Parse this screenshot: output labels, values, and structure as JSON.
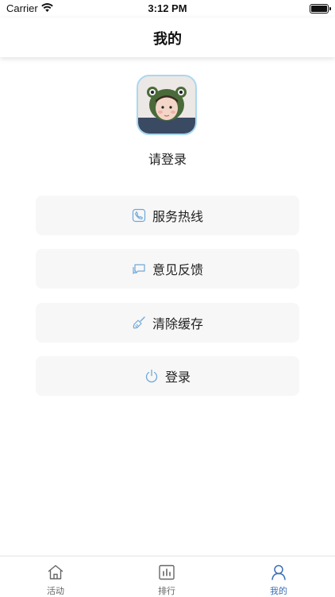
{
  "status_bar": {
    "carrier": "Carrier",
    "time": "3:12 PM"
  },
  "nav": {
    "title": "我的"
  },
  "profile": {
    "login_prompt": "请登录"
  },
  "menu": [
    {
      "label": "服务热线",
      "icon": "phone-icon"
    },
    {
      "label": "意见反馈",
      "icon": "chat-icon"
    },
    {
      "label": "清除缓存",
      "icon": "broom-icon"
    },
    {
      "label": "登录",
      "icon": "power-icon"
    }
  ],
  "tabs": [
    {
      "label": "活动",
      "icon": "home-icon",
      "active": false
    },
    {
      "label": "排行",
      "icon": "chart-icon",
      "active": false
    },
    {
      "label": "我的",
      "icon": "user-icon",
      "active": true
    }
  ],
  "colors": {
    "accent": "#3a6fb5",
    "icon_blue": "#6fa8d8",
    "menu_bg": "#f7f7f7"
  }
}
